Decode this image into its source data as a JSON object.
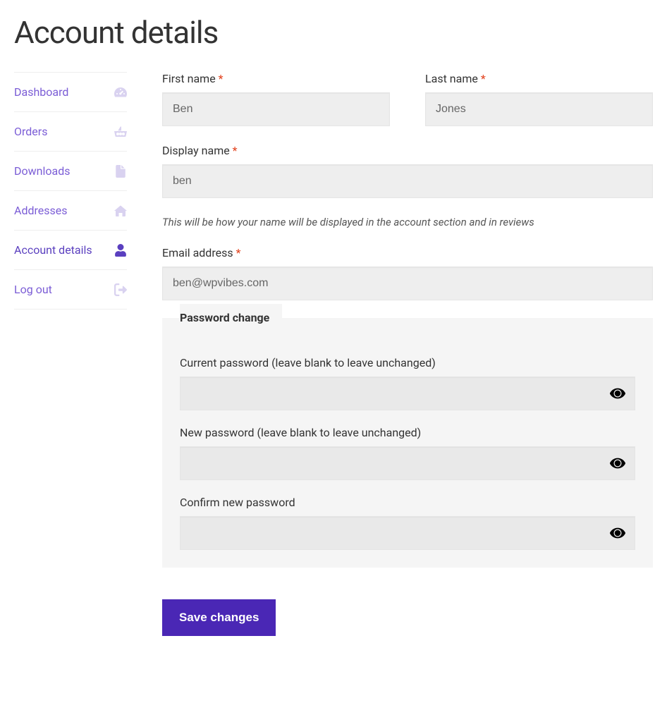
{
  "page": {
    "title": "Account details"
  },
  "sidebar": {
    "items": [
      {
        "label": "Dashboard"
      },
      {
        "label": "Orders"
      },
      {
        "label": "Downloads"
      },
      {
        "label": "Addresses"
      },
      {
        "label": "Account details"
      },
      {
        "label": "Log out"
      }
    ]
  },
  "form": {
    "first_name_label": "First name",
    "first_name_value": "Ben",
    "last_name_label": "Last name",
    "last_name_value": "Jones",
    "display_name_label": "Display name",
    "display_name_value": "ben",
    "display_name_help": "This will be how your name will be displayed in the account section and in reviews",
    "email_label": "Email address",
    "email_value": "ben@wpvibes.com",
    "required_mark": "*",
    "password_section": {
      "legend": "Password change"
    },
    "current_pwd_label": "Current password (leave blank to leave unchanged)",
    "current_pwd_value": "",
    "new_pwd_label": "New password (leave blank to leave unchanged)",
    "new_pwd_value": "",
    "confirm_pwd_label": "Confirm new password",
    "confirm_pwd_value": "",
    "save_label": "Save changes"
  }
}
